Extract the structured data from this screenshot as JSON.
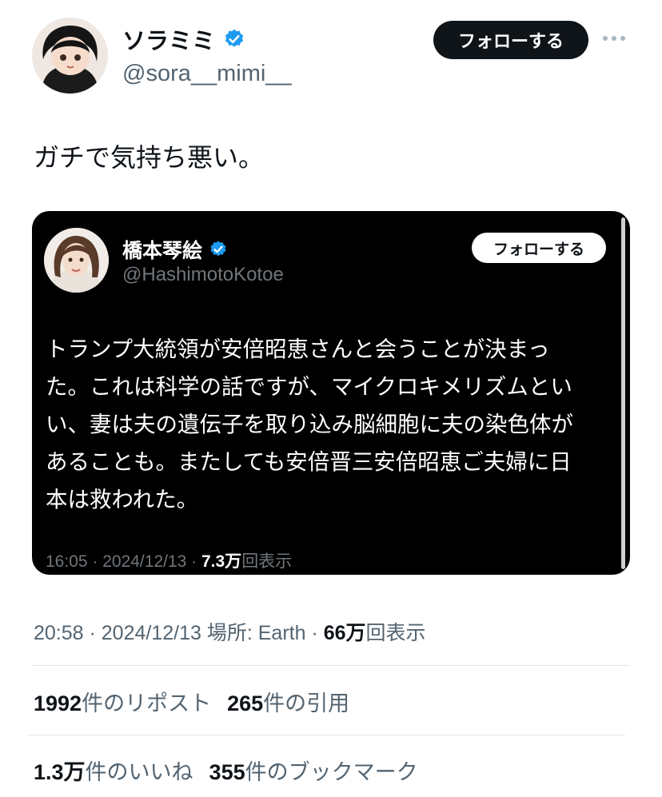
{
  "author": {
    "display_name": "ソラミミ",
    "handle": "@sora__mimi__",
    "verified_icon": "verified-badge-icon",
    "follow_label": "フォローする"
  },
  "tweet": {
    "text": "ガチで気持ち悪い。"
  },
  "quoted": {
    "display_name": "橋本琴絵",
    "handle": "@HashimotoKotoe",
    "follow_label": "フォローする",
    "lines": [
      "トランプ大統領が安倍昭恵さんと会うことが決まっ",
      "た。これは科学の話ですが、マイクロキメリズムとい",
      "い、妻は夫の遺伝子を取り込み脳細胞に夫の染色体が",
      "あることも。またしても安倍晋三安倍昭恵ご夫婦に日",
      "本は救われた。"
    ],
    "time": "16:05 · 2024/12/13 · ",
    "views_count": "7.3万",
    "views_label": "回表示"
  },
  "meta": {
    "time": "20:58 · 2024/12/13 場所: Earth · ",
    "views_count": "66万",
    "views_label": "回表示"
  },
  "stats": {
    "reposts_count": "1992",
    "reposts_label": "件のリポスト",
    "quotes_count": "265",
    "quotes_label": "件の引用",
    "likes_count": "1.3万",
    "likes_label": "件のいいね",
    "bookmarks_count": "355",
    "bookmarks_label": "件のブックマーク"
  },
  "colors": {
    "verified": "#1d9bf0",
    "follow_button": "#0f1419",
    "secondary_text": "#536471"
  }
}
